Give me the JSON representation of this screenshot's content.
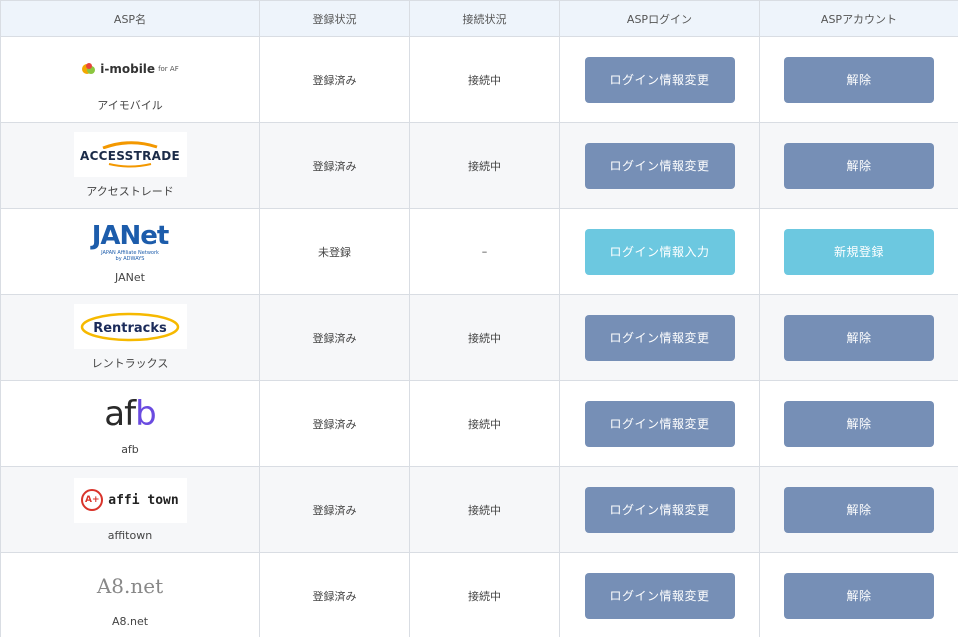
{
  "headers": {
    "asp_name": "ASP名",
    "registration_status": "登録状況",
    "connection_status": "接続状況",
    "asp_login": "ASPログイン",
    "asp_account": "ASPアカウント"
  },
  "logos": {
    "imobile": "i-mobile",
    "imobile_small": "for AF",
    "accesstrade": "ACCESSTRADE",
    "janet": "JANet",
    "janet_sub1": "JAPAN Affiliate Network",
    "janet_sub2": "by ADWAYS",
    "rentracks": "Rentracks",
    "afb_af": "af",
    "afb_b": "b",
    "affitown": "affi town",
    "affitown_badge": "A+",
    "a8": "A8.net"
  },
  "rows": [
    {
      "name": "アイモバイル",
      "registration": "登録済み",
      "connection": "接続中",
      "login_button": "ログイン情報変更",
      "account_button": "解除"
    },
    {
      "name": "アクセストレード",
      "registration": "登録済み",
      "connection": "接続中",
      "login_button": "ログイン情報変更",
      "account_button": "解除"
    },
    {
      "name": "JANet",
      "registration": "未登録",
      "connection": "–",
      "login_button": "ログイン情報入力",
      "account_button": "新規登録"
    },
    {
      "name": "レントラックス",
      "registration": "登録済み",
      "connection": "接続中",
      "login_button": "ログイン情報変更",
      "account_button": "解除"
    },
    {
      "name": "afb",
      "registration": "登録済み",
      "connection": "接続中",
      "login_button": "ログイン情報変更",
      "account_button": "解除"
    },
    {
      "name": "affitown",
      "registration": "登録済み",
      "connection": "接続中",
      "login_button": "ログイン情報変更",
      "account_button": "解除"
    },
    {
      "name": "A8.net",
      "registration": "登録済み",
      "connection": "接続中",
      "login_button": "ログイン情報変更",
      "account_button": "解除"
    }
  ],
  "colors": {
    "button_registered": "#768fb6",
    "button_unregistered": "#6cc8e0",
    "header_bg": "#eef4fb"
  }
}
